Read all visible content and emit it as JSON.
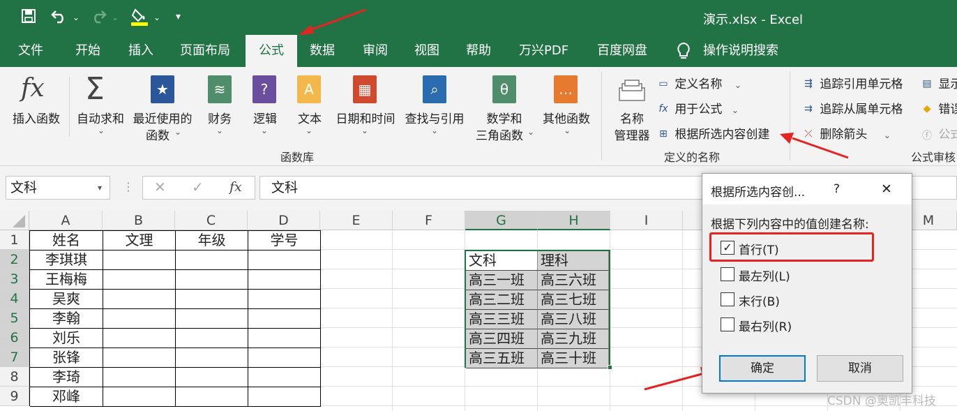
{
  "window": {
    "doc_title": "演示.xlsx  -  Excel"
  },
  "quick_access": {
    "save_icon": "save-icon",
    "undo_icon": "undo-icon",
    "redo_icon": "redo-icon",
    "fill_icon": "fill-color-icon",
    "more_icon": "customize-icon"
  },
  "tabs": [
    "文件",
    "开始",
    "插入",
    "页面布局",
    "公式",
    "数据",
    "审阅",
    "视图",
    "帮助",
    "万兴PDF",
    "百度网盘"
  ],
  "tell_me": "操作说明搜索",
  "ribbon": {
    "insert_function": "插入函数",
    "autosum": "自动求和",
    "recent_1": "最近使用的",
    "recent_2": "函数",
    "financial": "财务",
    "logical": "逻辑",
    "text": "文本",
    "datetime": "日期和时间",
    "lookup": "查找与引用",
    "math_1": "数学和",
    "math_2": "三角函数",
    "more": "其他函数",
    "group_library": "函数库",
    "name_mgr_1": "名称",
    "name_mgr_2": "管理器",
    "define_name": "定义名称",
    "use_in_formula": "用于公式",
    "create_from_sel": "根据所选内容创建",
    "group_defined": "定义的名称",
    "trace_precedents": "追踪引用单元格",
    "trace_dependents": "追踪从属单元格",
    "remove_arrows": "删除箭头",
    "show_formulas": "显示",
    "error_check": "错误",
    "evaluate": "公式",
    "group_audit": "公式审核"
  },
  "formula_bar": {
    "name_box": "文科",
    "content": "文科",
    "cancel": "✕",
    "enter": "✓",
    "fx": "fx"
  },
  "columns": [
    "A",
    "B",
    "C",
    "D",
    "E",
    "F",
    "G",
    "H",
    "I",
    "M"
  ],
  "rows": [
    "1",
    "2",
    "3",
    "4",
    "5",
    "6",
    "7",
    "8",
    "9"
  ],
  "sheet": {
    "headers": [
      "姓名",
      "文理",
      "年级",
      "学号"
    ],
    "names": [
      "李琪琪",
      "王梅梅",
      "吴爽",
      "李翰",
      "刘乐",
      "张锋",
      "李琦",
      "邓峰"
    ],
    "range_headers": [
      "文科",
      "理科"
    ],
    "wen": [
      "高三一班",
      "高三二班",
      "高三三班",
      "高三四班",
      "高三五班"
    ],
    "li": [
      "高三六班",
      "高三七班",
      "高三八班",
      "高三九班",
      "高三十班"
    ]
  },
  "dialog": {
    "title": "根据所选内容创...",
    "help": "?",
    "close": "✕",
    "prompt": "根据下列内容中的值创建名称:",
    "options": [
      {
        "label": "首行(T)",
        "checked": true
      },
      {
        "label": "最左列(L)",
        "checked": false
      },
      {
        "label": "末行(B)",
        "checked": false
      },
      {
        "label": "最右列(R)",
        "checked": false
      }
    ],
    "ok": "确定",
    "cancel": "取消"
  },
  "watermark": "CSDN @奥凯丰科技",
  "colors": {
    "excel_green": "#217346",
    "annotation_red": "#e52321"
  }
}
